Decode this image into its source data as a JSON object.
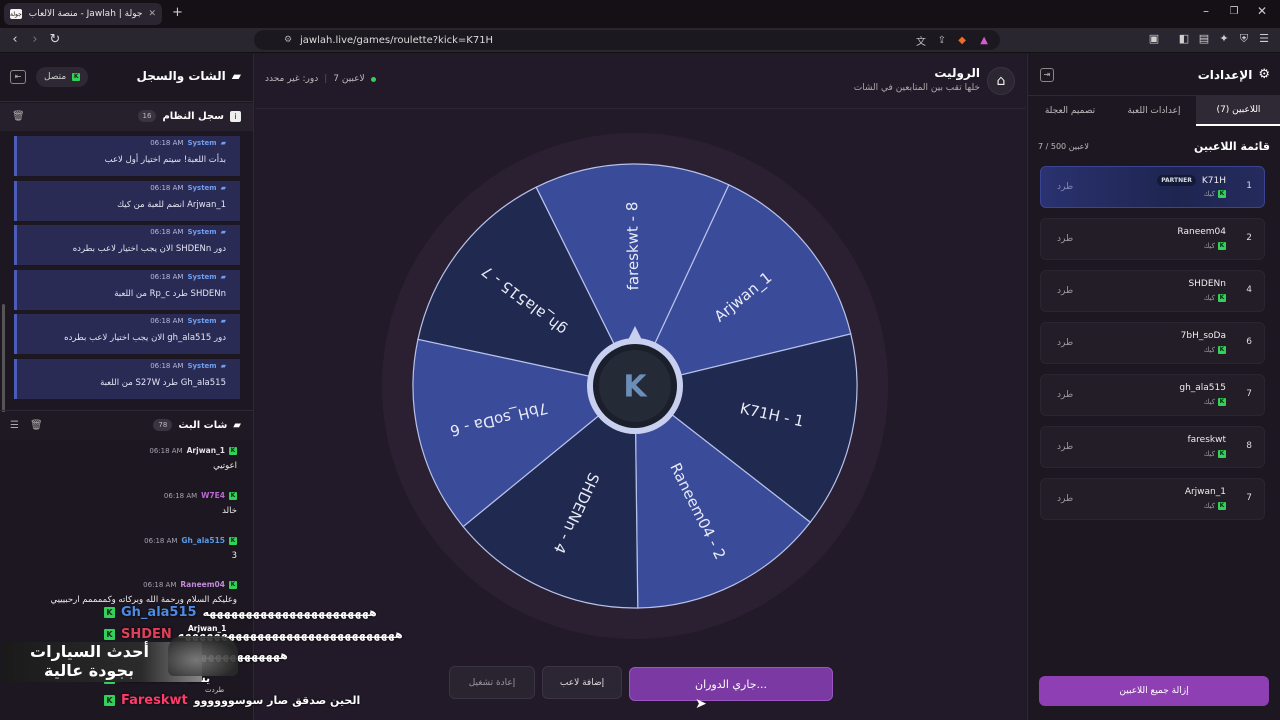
{
  "browser": {
    "tab_title": "جولة | Jawlah - منصة الألعاب التفا",
    "favicon_text": "جولة",
    "new_tab": "+",
    "url": "jawlah.live/games/roulette?kick=K71H",
    "nav_icons": [
      "chevron-left-icon",
      "chevron-right-icon",
      "reload-icon"
    ]
  },
  "left_panel": {
    "title": "الشات والسجل",
    "status": "متصل",
    "system_log": {
      "title": "سجل النظام",
      "count": "16",
      "entries": [
        {
          "sender": "System",
          "time": "06:18 AM",
          "msg": "بدأت اللعبة! سيتم اختيار أول لاعب"
        },
        {
          "sender": "System",
          "time": "06:18 AM",
          "msg": "Arjwan_1 انضم للعبة من كيك"
        },
        {
          "sender": "System",
          "time": "06:18 AM",
          "msg": "دور SHDENn الان يجب اختيار لاعب بطرده"
        },
        {
          "sender": "System",
          "time": "06:18 AM",
          "msg": "SHDENn طرد Rp_c من اللعبة"
        },
        {
          "sender": "System",
          "time": "06:18 AM",
          "msg": "دور gh_ala515 الان يجب اختيار لاعب بطرده"
        },
        {
          "sender": "System",
          "time": "06:18 AM",
          "msg": "Gh_ala515 طرد S27W من اللعبة"
        }
      ]
    },
    "stream_chat": {
      "title": "شات البث",
      "count": "78",
      "messages": [
        {
          "user": "Arjwan_1",
          "time": "06:18 AM",
          "msg": "اعوتيي",
          "color": "#e6e2ea"
        },
        {
          "user": "W7E4",
          "time": "06:18 AM",
          "msg": "خالد",
          "color": "#b86ad0"
        },
        {
          "user": "Gh_ala515",
          "time": "06:18 AM",
          "msg": "3",
          "color": "#5a9ae6"
        },
        {
          "user": "Raneem04",
          "time": "06:18 AM",
          "msg": "وعليكم السلام ورحمة الله وبركاته وكممممم ارحبيييي",
          "color": "#c08ad8"
        }
      ]
    }
  },
  "overlay": {
    "lines": [
      {
        "name": "Gh_ala515",
        "text": "هههههههههههههههههههههههه"
      },
      {
        "name": "SHDEN",
        "text": "ههههههههههههههههههههههههههههههه"
      },
      {
        "name": "",
        "text": "ههههههههههههههههههههههه"
      },
      {
        "name": "Raneem",
        "text": "يستا"
      },
      {
        "name": "Fareskwt",
        "text": "الحين صدقق صار سوسوووووو"
      }
    ],
    "ad_line1": "أحدث السيارات",
    "ad_line2": "بجودة عالية",
    "arjwan": "Arjwan_1",
    "subtext": "طردت"
  },
  "center": {
    "game_title": "الروليت",
    "game_subtitle": "خلها تقب بين المتابعين في الشات",
    "players_count": "7 لاعبين",
    "turn": "دور: غير محدد",
    "buttons": {
      "spinning": "جاري الدوران...",
      "add_player": "إضافة لاعب",
      "restart": "إعادة تشغيل"
    }
  },
  "wheel": {
    "segments": [
      "Arjwan_1",
      "K71H - 1",
      "Raneem04 - 2",
      "SHDENn - 4",
      "7bH_soDa - 6",
      "gh_ala515 - 7",
      "fareskwt - 8"
    ],
    "colors": [
      "#3a4b9a",
      "#20294f"
    ],
    "hub": "K"
  },
  "right_panel": {
    "title": "الإعدادات",
    "tabs": [
      "اللاعبين (7)",
      "إعدادات اللعبة",
      "تصميم العجلة"
    ],
    "list_title": "قائمة اللاعبين",
    "list_count": "7 / 500 لاعبين",
    "players": [
      {
        "num": "1",
        "name": "K71H",
        "platform": "كيك",
        "badge": "PARTNER",
        "kick": "طرد"
      },
      {
        "num": "2",
        "name": "Raneem04",
        "platform": "كيك",
        "kick": "طرد"
      },
      {
        "num": "4",
        "name": "SHDENn",
        "platform": "كيك",
        "kick": "طرد"
      },
      {
        "num": "6",
        "name": "7bH_soDa",
        "platform": "كيك",
        "kick": "طرد"
      },
      {
        "num": "7",
        "name": "gh_ala515",
        "platform": "كيك",
        "kick": "طرد"
      },
      {
        "num": "8",
        "name": "fareskwt",
        "platform": "كيك",
        "kick": "طرد"
      },
      {
        "num": "7",
        "name": "Arjwan_1",
        "platform": "كيك",
        "kick": "طرد"
      }
    ],
    "remove_all": "إزالة جميع اللاعبين"
  }
}
